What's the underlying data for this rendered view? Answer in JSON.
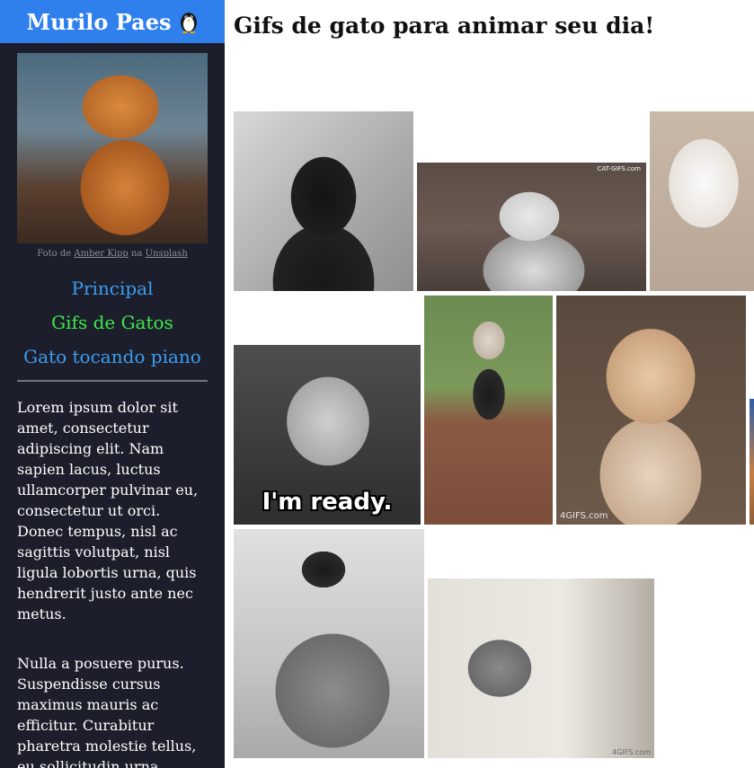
{
  "brand": {
    "name": "Murilo Paes",
    "icon": "penguin-icon"
  },
  "sidebar": {
    "photo_credit": {
      "prefix": "Foto de",
      "author": "Amber Kipp",
      "middle": "na",
      "site": "Unsplash"
    },
    "nav": [
      {
        "label": "Principal",
        "color": "#3d9cf0"
      },
      {
        "label": "Gifs de Gatos",
        "color": "#3ee84a"
      },
      {
        "label": "Gato tocando piano",
        "color": "#3d9cf0"
      }
    ],
    "paragraphs": [
      "Lorem ipsum dolor sit amet, consectetur adipiscing elit. Nam sapien lacus, luctus ullamcorper pulvinar eu, consectetur ut orci. Donec tempus, nisl ac sagittis volutpat, nisl ligula lobortis urna, quis hendrerit justo ante nec metus.",
      "Nulla a posuere purus. Suspendisse cursus maximus mauris ac efficitur. Curabitur pharetra molestie tellus, eu sollicitudin urna convallis"
    ]
  },
  "main": {
    "heading": "Gifs de gato para animar seu dia!",
    "gifs": [
      {
        "caption": ""
      },
      {
        "caption": "CAT-GIFS.com"
      },
      {
        "caption": ""
      },
      {
        "caption": "I'm ready."
      },
      {
        "caption": ""
      },
      {
        "caption": "4GIFS.com"
      },
      {
        "caption": ""
      },
      {
        "caption": ""
      },
      {
        "caption": "4GIFS.com"
      }
    ]
  },
  "colors": {
    "sidebar_bg": "#1c1f2b",
    "brand_bg": "#2f80ed",
    "link_blue": "#3d9cf0",
    "link_active_green": "#3ee84a"
  }
}
